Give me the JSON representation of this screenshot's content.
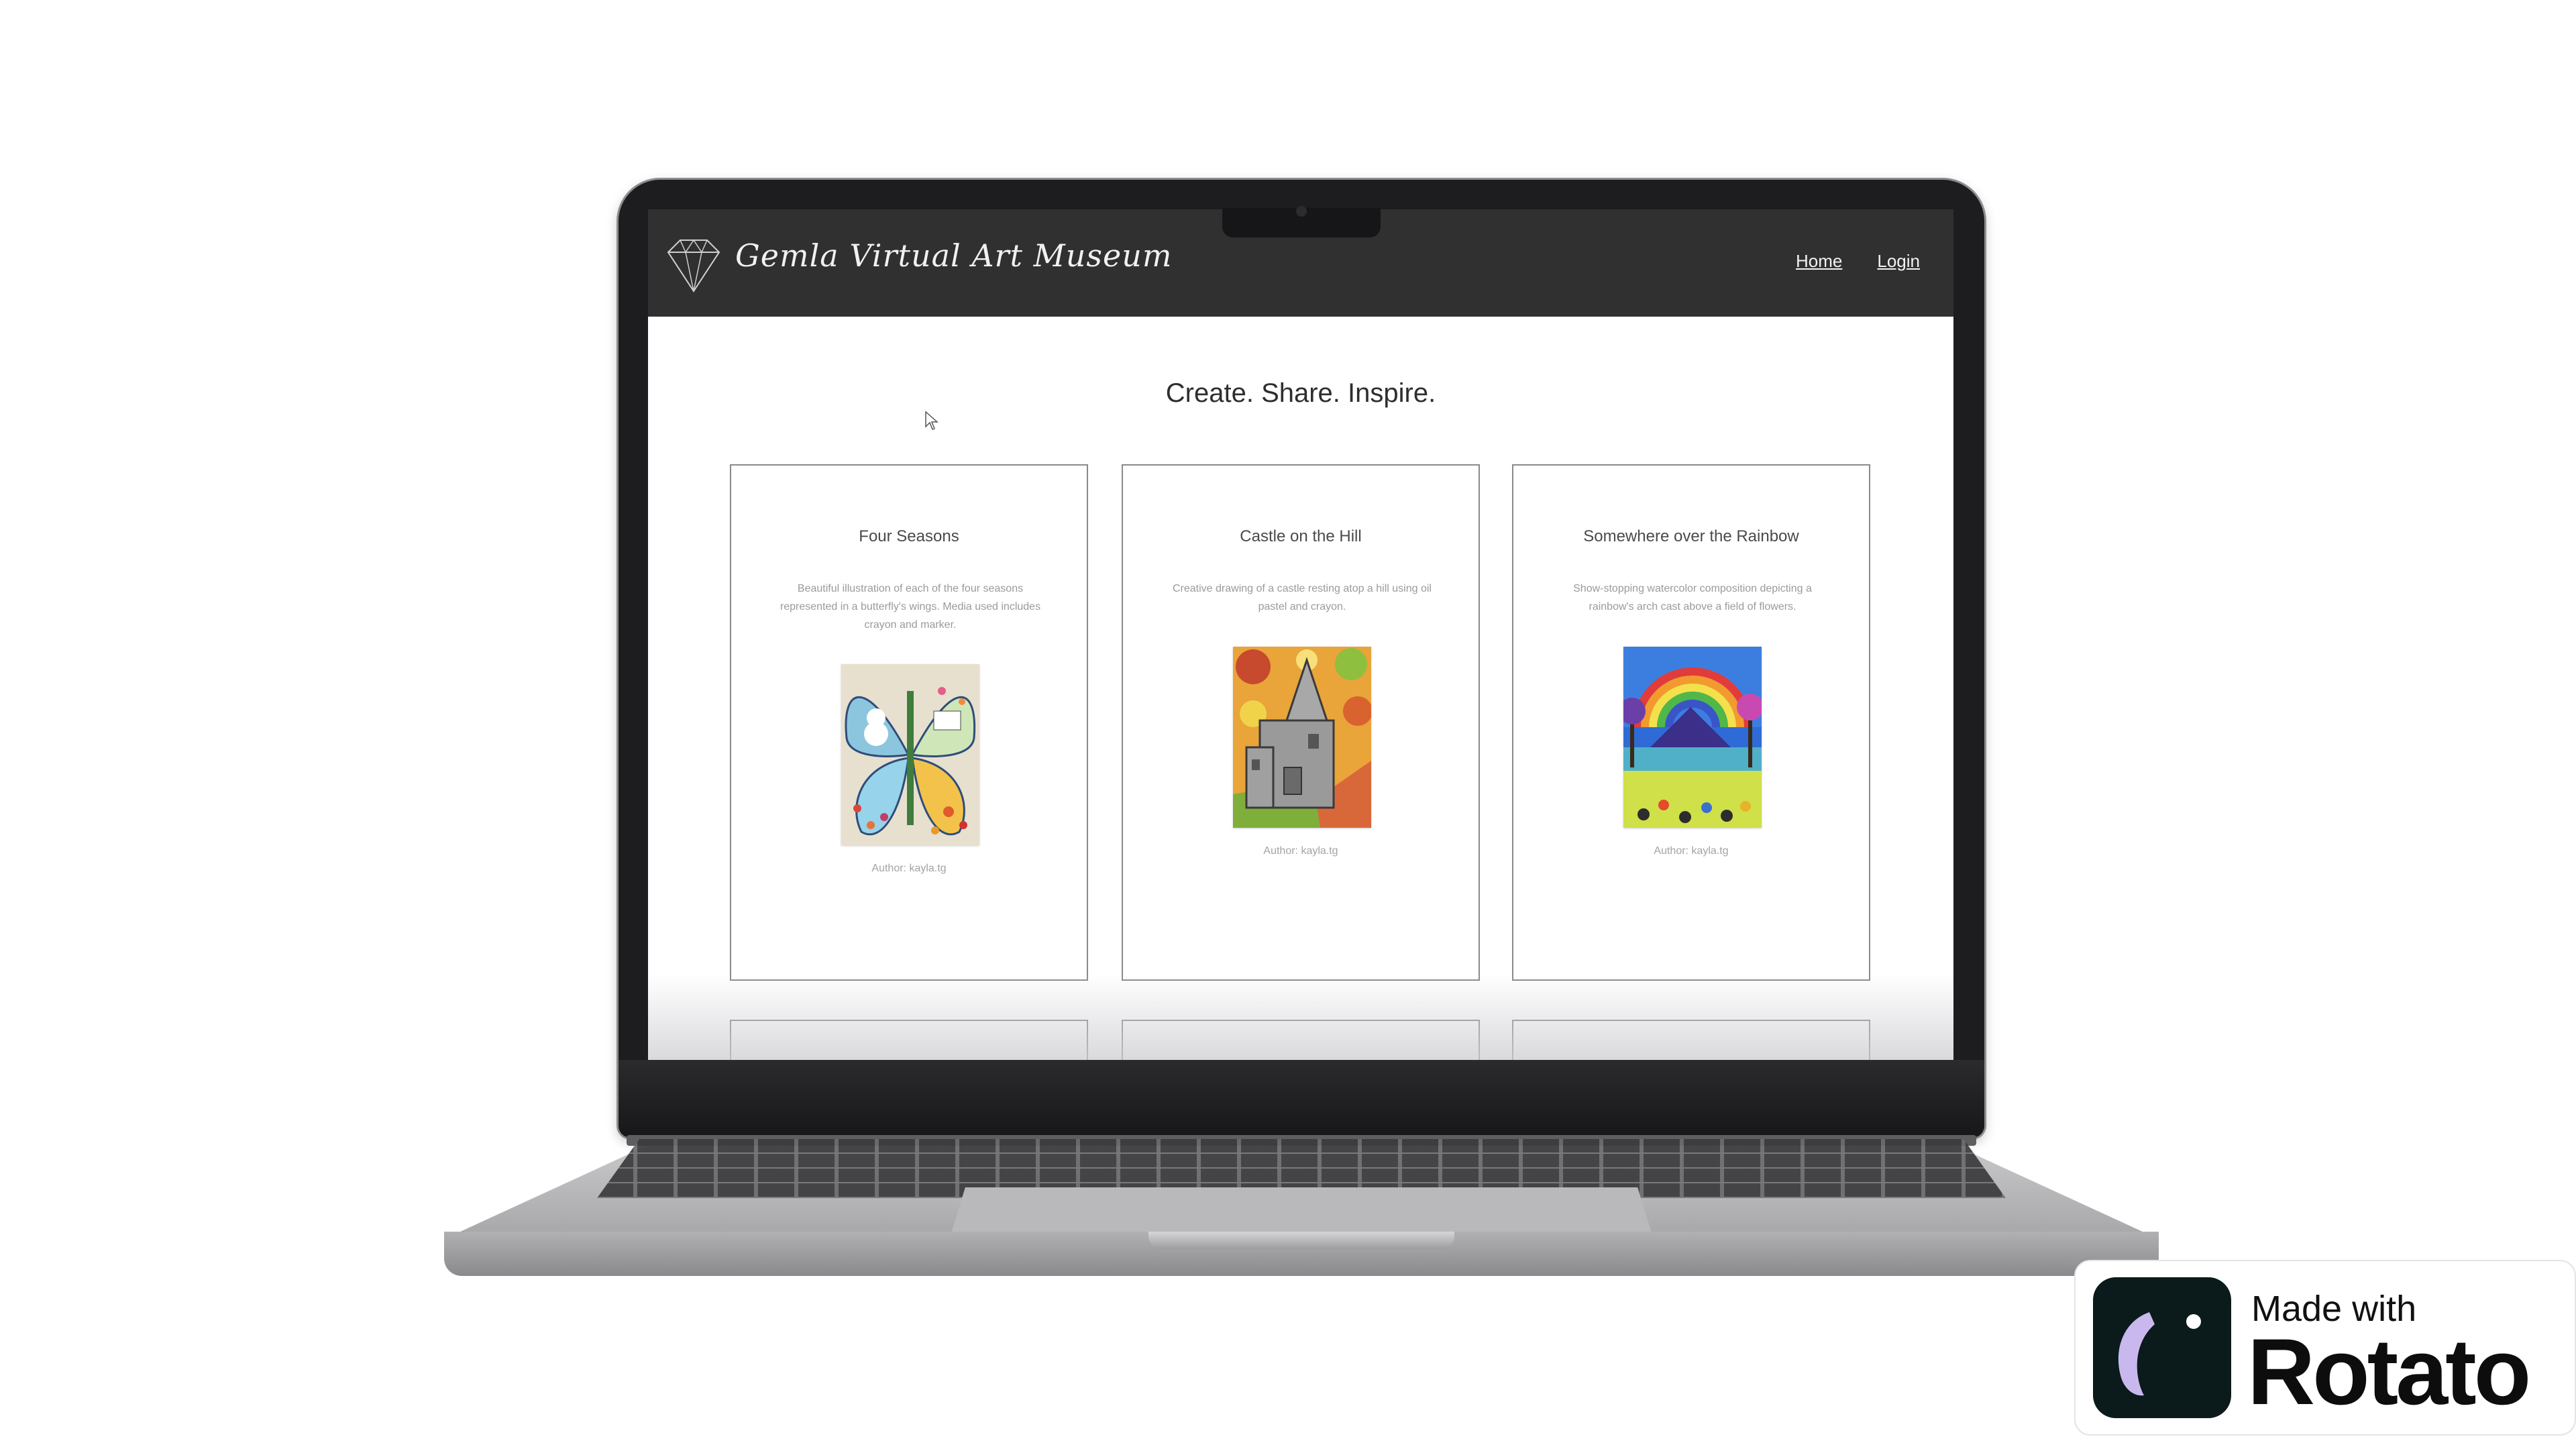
{
  "site": {
    "title": "Gemla Virtual Art Museum",
    "nav": {
      "home": "Home",
      "login": "Login"
    },
    "headline": "Create. Share. Inspire."
  },
  "artworks": [
    {
      "title": "Four Seasons",
      "description": "Beautiful illustration of each of the four seasons represented in a butterfly's wings. Media used includes crayon and marker.",
      "author": "Author: kayla.tg"
    },
    {
      "title": "Castle on the Hill",
      "description": "Creative drawing of a castle resting atop a hill using oil pastel and crayon.",
      "author": "Author: kayla.tg"
    },
    {
      "title": "Somewhere over the Rainbow",
      "description": "Show-stopping watercolor composition depicting a rainbow's arch cast above a field of flowers.",
      "author": "Author: kayla.tg"
    }
  ],
  "icons": {
    "logo": "diamond-icon",
    "cursor": "mouse-pointer-icon",
    "badge": "rotato-logo-icon"
  },
  "badge": {
    "made_with": "Made with",
    "brand": "Rotato"
  },
  "colors": {
    "navbar": "#303030",
    "page": "#ffffff",
    "badge_icon": "#0b1a1a"
  }
}
